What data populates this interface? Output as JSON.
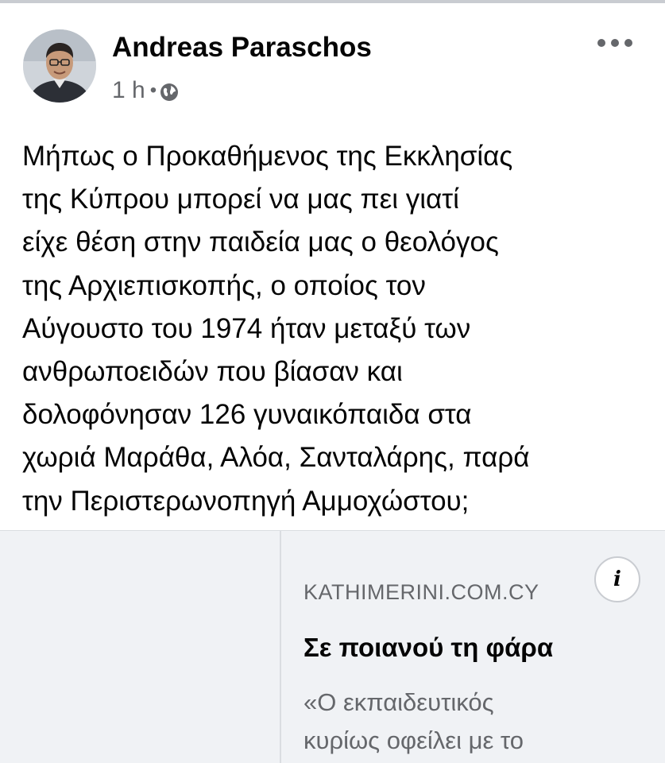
{
  "post": {
    "author": "Andreas Paraschos",
    "time": "1 h",
    "separator": "•",
    "privacy_icon": "globe-icon",
    "more_icon": "more-options-icon",
    "avatar_icon": "profile-photo-avatar",
    "body_lines": [
      "Μήπως ο Προκαθήμενος της Εκκλησίας",
      "της Κύπρου μπορεί να μας πει γιατί",
      "είχε θέση στην παιδεία μας ο θεολόγος",
      "της Αρχιεπισκοπής, ο οποίος τον",
      "Αύγουστο του 1974 ήταν μεταξύ των",
      "ανθρωποειδών που βίασαν και",
      "δολοφόνησαν 126 γυναικόπαιδα στα",
      "χωριά Μαράθα, Αλόα, Σανταλάρης, παρά",
      "την Περιστερωνοπηγή Αμμοχώστου;"
    ]
  },
  "link_card": {
    "domain": "KATHIMERINI.COM.CY",
    "title": "Σε ποιανού τη φάρα",
    "description_lines": [
      "«Ο εκπαιδευτικός",
      "κυρίως οφείλει με το"
    ],
    "info_glyph": "i",
    "info_icon": "info-icon"
  },
  "colors": {
    "primary_text": "#050505",
    "secondary_text": "#65676b",
    "card_background": "#f0f2f5",
    "divider": "#dadde1"
  }
}
